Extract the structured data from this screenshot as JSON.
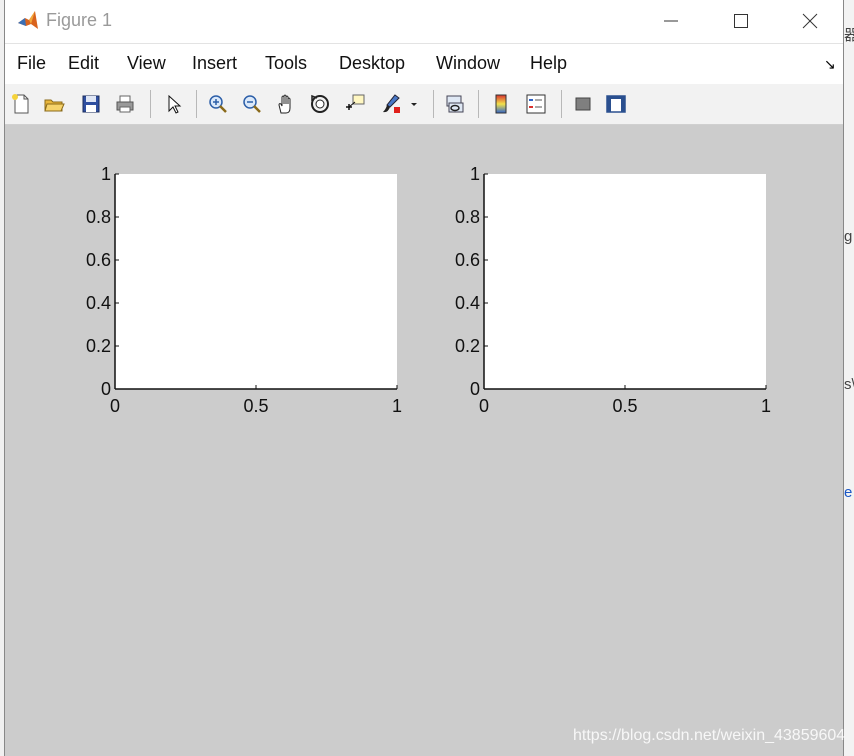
{
  "window": {
    "title": "Figure 1"
  },
  "menu": [
    "File",
    "Edit",
    "View",
    "Insert",
    "Tools",
    "Desktop",
    "Window",
    "Help"
  ],
  "toolbar_icons": [
    "new-figure-icon",
    "open-file-icon",
    "save-icon",
    "print-icon",
    "pointer-icon",
    "zoom-in-icon",
    "zoom-out-icon",
    "pan-hand-icon",
    "rotate-3d-icon",
    "data-cursor-icon",
    "brush-icon",
    "link-plot-icon",
    "colorbar-icon",
    "legend-icon",
    "hide-plot-tools-icon",
    "show-plot-tools-icon"
  ],
  "chart_data": [
    {
      "type": "line",
      "x": [],
      "y": [],
      "xlim": [
        0,
        1
      ],
      "ylim": [
        0,
        1
      ],
      "xticks": [
        "0",
        "0.5",
        "1"
      ],
      "yticks": [
        "0",
        "0.2",
        "0.4",
        "0.6",
        "0.8",
        "1"
      ]
    },
    {
      "type": "line",
      "x": [],
      "y": [],
      "xlim": [
        0,
        1
      ],
      "ylim": [
        0,
        1
      ],
      "xticks": [
        "0",
        "0.5",
        "1"
      ],
      "yticks": [
        "0",
        "0.2",
        "0.4",
        "0.6",
        "0.8",
        "1"
      ]
    }
  ],
  "background": {
    "right_fragments": [
      "器",
      "g",
      "s\\",
      "e"
    ]
  },
  "watermark": "https://blog.csdn.net/weixin_43859604"
}
